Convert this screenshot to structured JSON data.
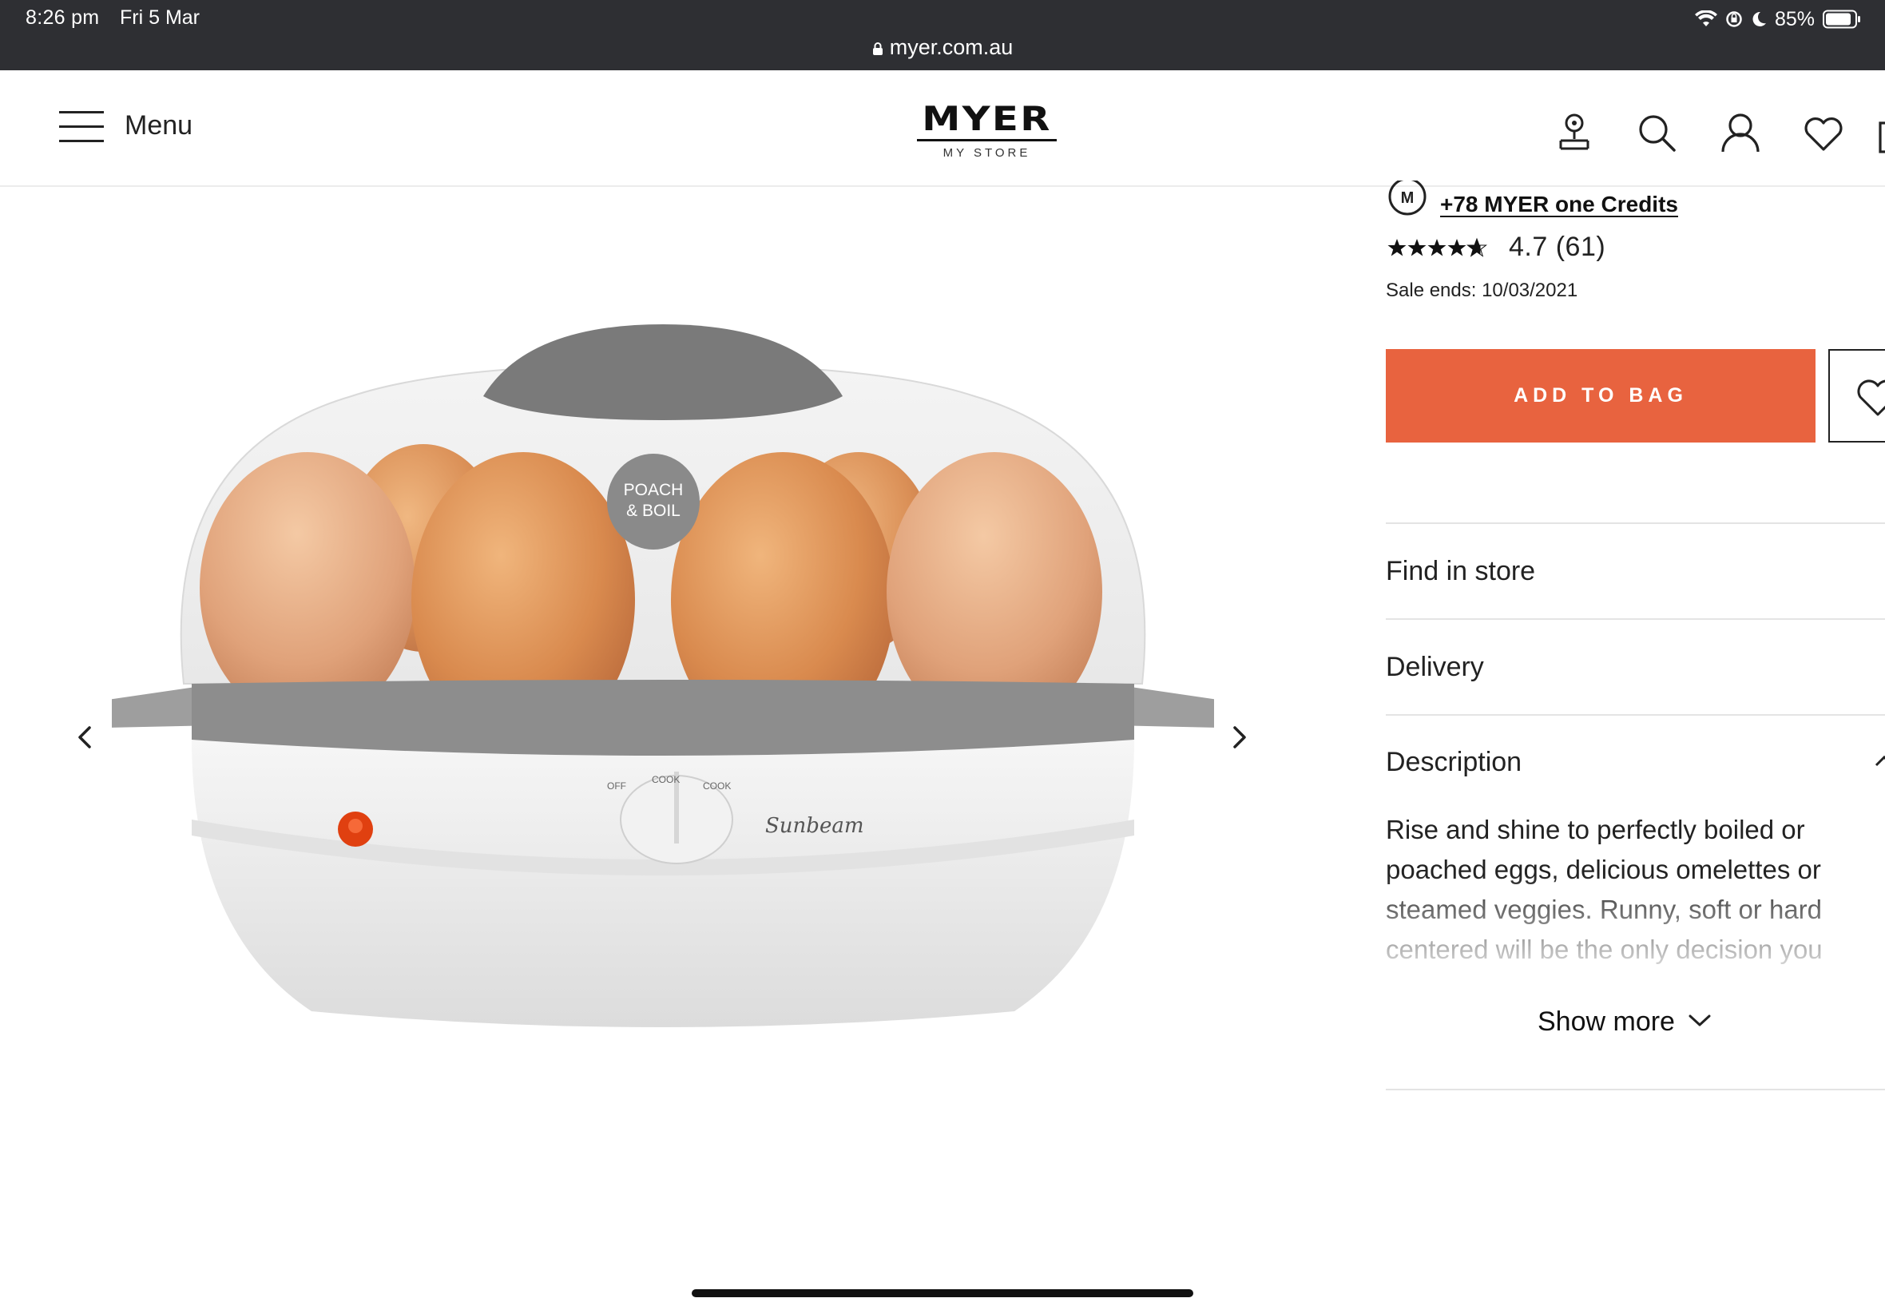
{
  "status_bar": {
    "time": "8:26 pm",
    "date": "Fri 5 Mar",
    "battery": "85%",
    "url": "myer.com.au"
  },
  "header": {
    "menu_label": "Menu",
    "logo_text": "MYER",
    "logo_subtext": "MY STORE",
    "icons": [
      "store-locator-icon",
      "search-icon",
      "account-icon",
      "wishlist-icon",
      "bag-icon"
    ]
  },
  "product": {
    "credits_text": "+78 MYER one Credits",
    "rating_value": "4.7 (61)",
    "rating_stars": 4.7,
    "sale_ends": "Sale ends: 10/03/2021",
    "add_to_bag": "ADD TO BAG",
    "image_labels": {
      "badge": "POACH & BOIL",
      "brand": "Sunbeam",
      "dial_off": "OFF",
      "dial_cook": "COOK",
      "dial_cook2": "COOK"
    }
  },
  "accordion": [
    {
      "label": "Find in store"
    },
    {
      "label": "Delivery"
    },
    {
      "label": "Description"
    }
  ],
  "description": {
    "text": "Rise and shine to perfectly boiled or poached eggs, delicious omelettes or steamed veggies. Runny, soft or hard centered will be the only decision you",
    "show_more": "Show more"
  },
  "colors": {
    "accent": "#e8633f",
    "status_bar": "#2e2f33"
  }
}
